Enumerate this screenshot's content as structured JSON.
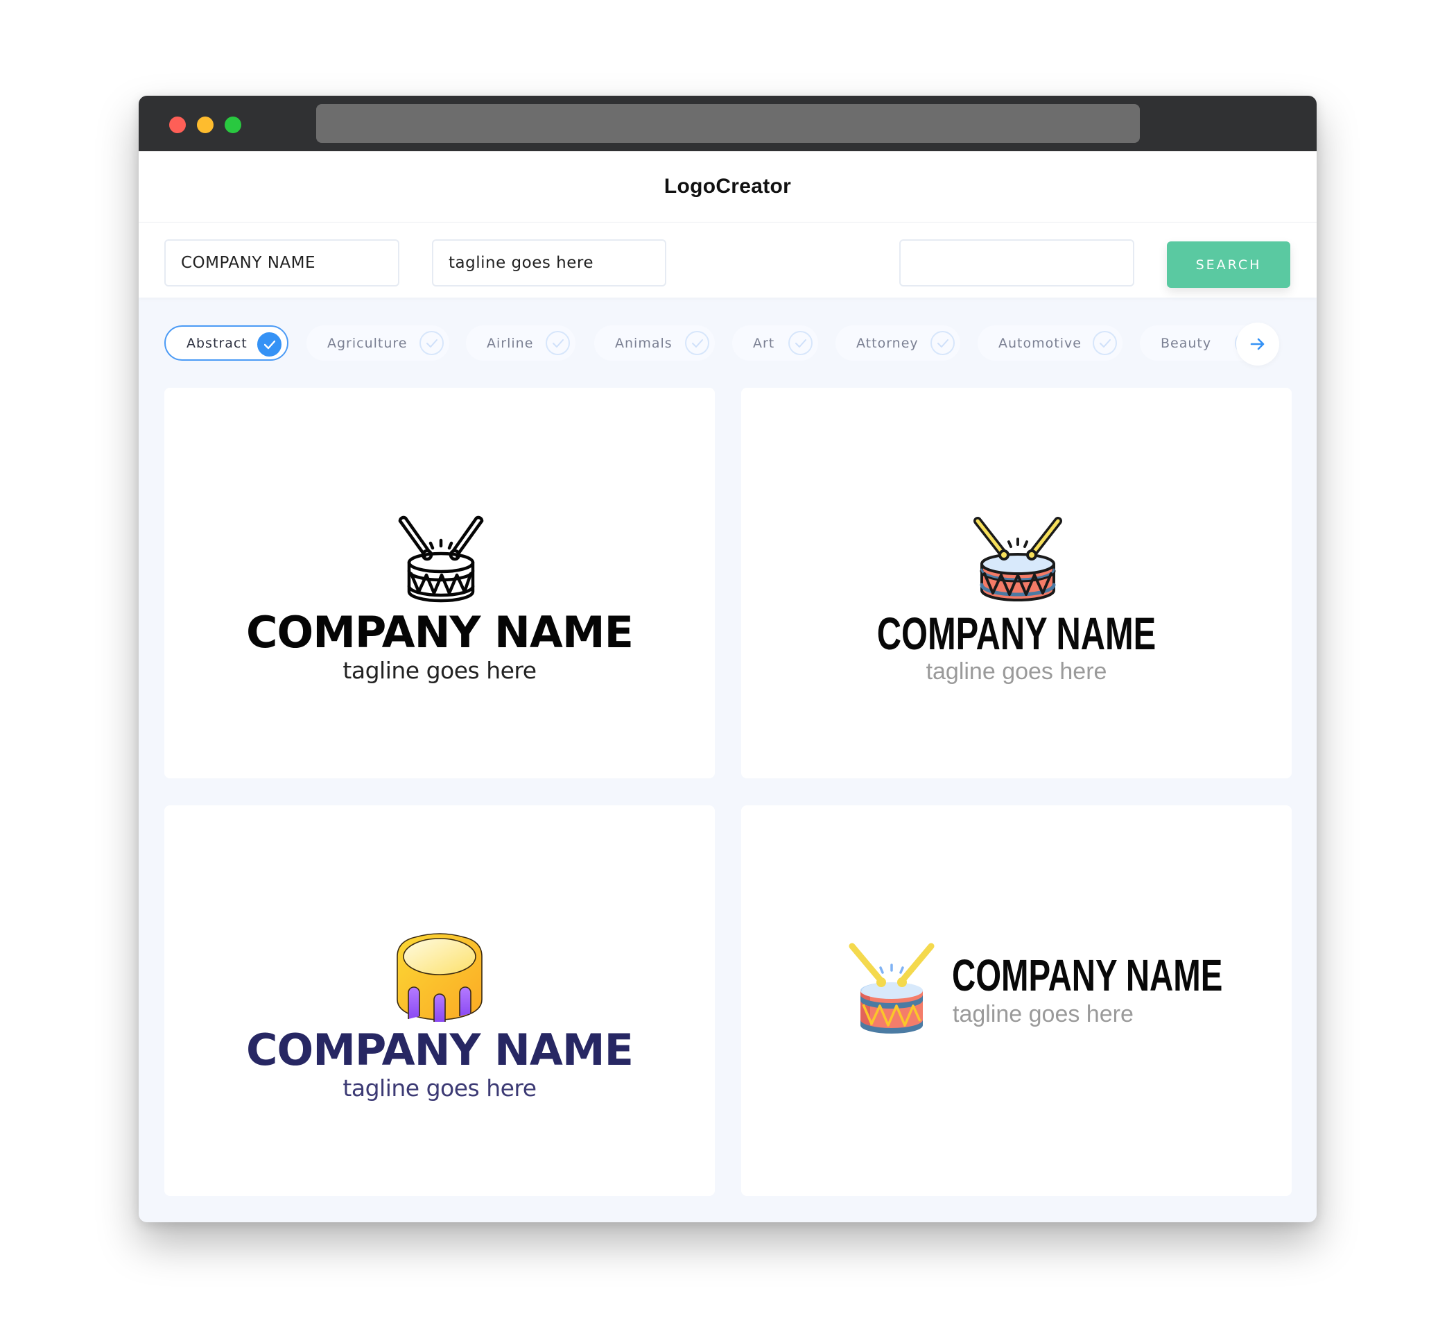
{
  "window": {
    "traffic_lights": [
      "close",
      "minimize",
      "maximize"
    ],
    "url": ""
  },
  "header": {
    "brand": "LogoCreator"
  },
  "search": {
    "company_name": "COMPANY NAME",
    "tagline": "tagline goes here",
    "keyword": "",
    "button_label": "SEARCH"
  },
  "categories": {
    "items": [
      {
        "label": "Abstract",
        "selected": true
      },
      {
        "label": "Agriculture",
        "selected": false
      },
      {
        "label": "Airline",
        "selected": false
      },
      {
        "label": "Animals",
        "selected": false
      },
      {
        "label": "Art",
        "selected": false
      },
      {
        "label": "Attorney",
        "selected": false
      },
      {
        "label": "Automotive",
        "selected": false
      },
      {
        "label": "Beauty",
        "selected": false
      }
    ],
    "next_icon": "arrow-right-icon"
  },
  "colors": {
    "accent_blue": "#3592f5",
    "search_green": "#5ac9a1",
    "navy_text": "#272763"
  },
  "logos": [
    {
      "company": "COMPANY NAME",
      "tagline": "tagline goes here",
      "icon": "drum-outline-icon",
      "layout": "stacked"
    },
    {
      "company": "COMPANY NAME",
      "tagline": "tagline goes here",
      "icon": "drum-color-outline-icon",
      "layout": "stacked"
    },
    {
      "company": "COMPANY NAME",
      "tagline": "tagline goes here",
      "icon": "drum-gradient-icon",
      "layout": "stacked"
    },
    {
      "company": "COMPANY NAME",
      "tagline": "tagline goes here",
      "icon": "drum-flat-icon",
      "layout": "inline"
    }
  ]
}
